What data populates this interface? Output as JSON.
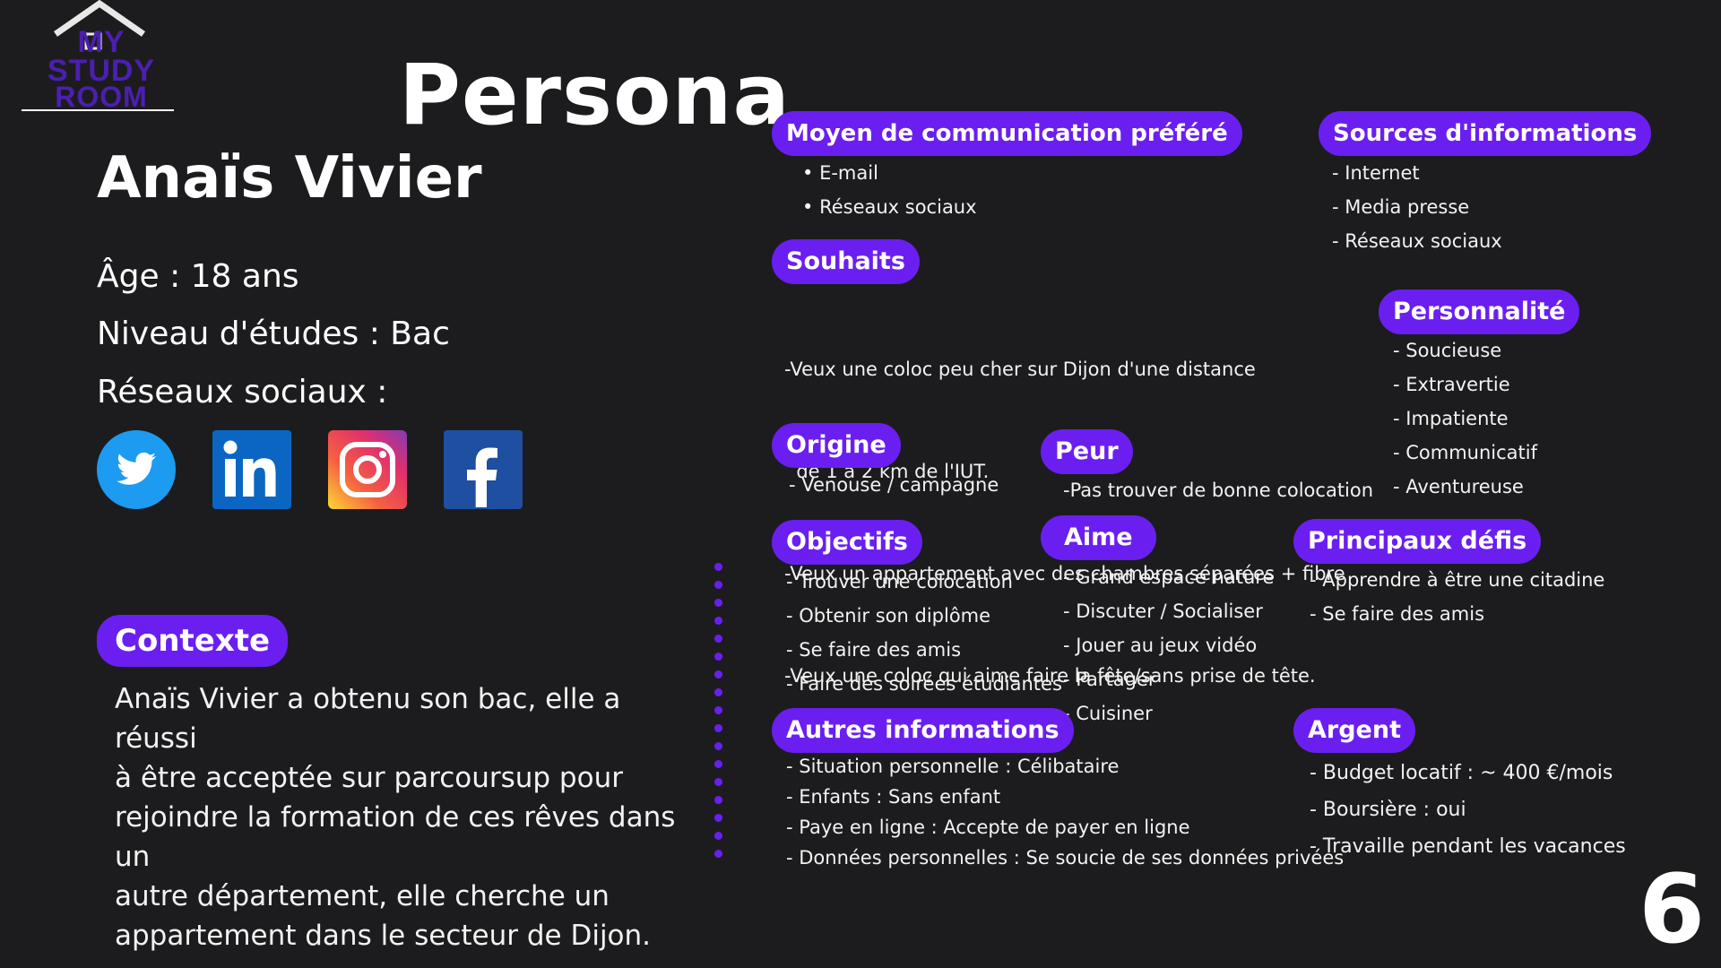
{
  "logo": {
    "line1": "MY",
    "line2": "STUDY",
    "line3": "ROOM"
  },
  "title": "Persona",
  "name": "Anaïs Vivier",
  "age": "Âge : 18 ans",
  "education": "Niveau d'études : Bac",
  "social_label": "Réseaux sociaux :",
  "social_icons": [
    "twitter-icon",
    "linkedin-icon",
    "instagram-icon",
    "facebook-icon"
  ],
  "contexte": {
    "label": "Contexte",
    "lines": [
      "Anaïs Vivier a obtenu son bac, elle a réussi",
      "à être acceptée sur parcoursup pour",
      "rejoindre la formation de ces rêves dans un",
      "autre département, elle cherche un",
      "appartement dans le secteur de Dijon."
    ]
  },
  "communication": {
    "label": "Moyen de communication préféré",
    "items": [
      "E-mail",
      "Réseaux sociaux"
    ]
  },
  "souhaits": {
    "label": "Souhaits",
    "items": [
      "-Veux une coloc peu cher sur Dijon d'une distance",
      "  de 1 à 2 km de l'IUT.",
      "-Veux un appartement avec des chambres séparées + fibre",
      "-Veux une coloc qui aime faire la fête/sans prise de tête."
    ]
  },
  "origine": {
    "label": "Origine",
    "items": [
      "- Venouse / campagne"
    ]
  },
  "peur": {
    "label": "Peur",
    "items": [
      "-Pas trouver de bonne colocation"
    ]
  },
  "objectifs": {
    "label": "Objectifs",
    "items": [
      "- Trouver une colocation",
      "- Obtenir son diplôme",
      "- Se faire des amis",
      "- Faire des soirées étudiantes"
    ]
  },
  "aime": {
    "label": "Aime",
    "items": [
      "- Grand espace nature",
      "- Discuter / Socialiser",
      "- Jouer au jeux vidéo",
      "- Partager",
      "- Cuisiner"
    ]
  },
  "sources": {
    "label": "Sources d'informations",
    "items": [
      "- Internet",
      "- Media presse",
      "- Réseaux sociaux"
    ]
  },
  "personnalite": {
    "label": "Personnalité",
    "items": [
      "- Soucieuse",
      "- Extravertie",
      "- Impatiente",
      "- Communicatif",
      "- Aventureuse"
    ]
  },
  "defis": {
    "label": "Principaux défis",
    "items": [
      "- Apprendre à être une citadine",
      "- Se faire des amis"
    ]
  },
  "autres": {
    "label": "Autres informations",
    "items": [
      "- Situation personnelle : Célibataire",
      "- Enfants : Sans enfant",
      "- Paye en ligne : Accepte de payer en ligne",
      "- Données personnelles : Se soucie de ses données privées"
    ]
  },
  "argent": {
    "label": "Argent",
    "items": [
      "- Budget locatif : ~ 400 €/mois",
      "- Boursière : oui",
      "- Travaille pendant les vacances"
    ]
  },
  "page_number": "6",
  "colors": {
    "accent": "#6a1ff0",
    "background": "#1c1c1e",
    "logo": "#4b1fb0"
  }
}
